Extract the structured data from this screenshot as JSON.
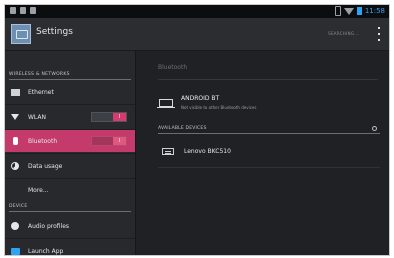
{
  "status_bar": {
    "time": "11:58",
    "icons": [
      "notification-icon",
      "notification-icon",
      "notification-icon",
      "bluetooth-icon",
      "wifi-icon",
      "battery-icon"
    ]
  },
  "action_bar": {
    "title": "Settings",
    "search_label": "SEARCHING...",
    "overflow_icon": "overflow-menu-icon"
  },
  "sidebar": {
    "section_wireless": "WIRELESS & NETWORKS",
    "section_device": "DEVICE",
    "items": [
      {
        "label": "Ethernet",
        "icon": "ethernet-icon"
      },
      {
        "label": "WLAN",
        "icon": "wifi-icon",
        "toggle": "I"
      },
      {
        "label": "Bluetooth",
        "icon": "bluetooth-icon",
        "toggle": "I",
        "selected": true
      },
      {
        "label": "Data usage",
        "icon": "data-usage-icon"
      },
      {
        "label": "More...",
        "icon": ""
      },
      {
        "label": "Audio profiles",
        "icon": "audio-profiles-icon"
      },
      {
        "label": "Launch App",
        "icon": "launch-app-icon"
      }
    ]
  },
  "detail": {
    "title": "Bluetooth",
    "this_device": {
      "name": "ANDROID BT",
      "subtitle": "Not visible to other Bluetooth devices"
    },
    "available_header": "AVAILABLE DEVICES",
    "devices": [
      {
        "name": "Lenovo BKC510",
        "icon": "keyboard-icon"
      }
    ]
  },
  "colors": {
    "accent": "#c43b6b",
    "status_blue": "#2ea3f2",
    "background": "#202124"
  }
}
